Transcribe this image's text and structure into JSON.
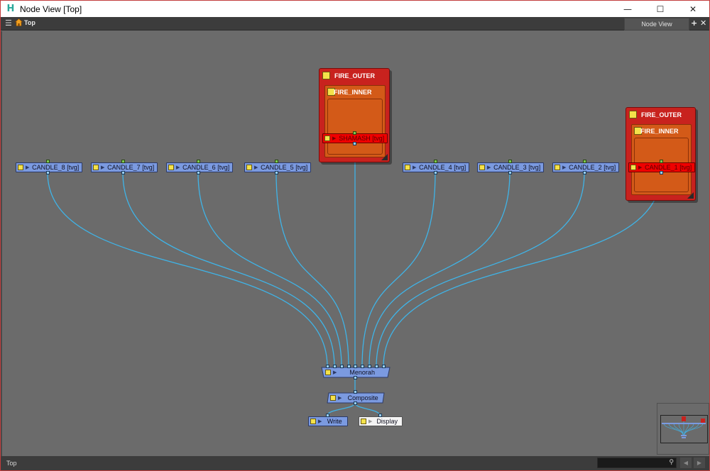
{
  "window": {
    "title": "Node View [Top]",
    "minimize_icon": "minimize-icon",
    "maximize_icon": "maximize-icon",
    "close_icon": "close-icon"
  },
  "toolbar": {
    "breadcrumb": "Top",
    "tab_label": "Node View"
  },
  "groups": {
    "shamash": {
      "outer": "FIRE_OUTER",
      "inner": "FIRE_INNER"
    },
    "candle1": {
      "outer": "FIRE_OUTER",
      "inner": "FIRE_INNER"
    }
  },
  "nodes": {
    "candle_8": "CANDLE_8  [tvg]",
    "candle_7": "CANDLE_7  [tvg]",
    "candle_6": "CANDLE_6  [tvg]",
    "candle_5": "CANDLE_5  [tvg]",
    "shamash": "SHAMASH  [tvg]",
    "candle_4": "CANDLE_4  [tvg]",
    "candle_3": "CANDLE_3  [tvg]",
    "candle_2": "CANDLE_2  [tvg]",
    "candle_1": "CANDLE_1  [tvg]",
    "menorah": "Menorah",
    "composite": "Composite",
    "write": "Write",
    "display": "Display"
  },
  "statusbar": {
    "text": "Top"
  },
  "colors": {
    "wire": "#3fb4e8",
    "node": "#7b9ae0",
    "selected_node": "#f00000",
    "group_outer": "#c8221e",
    "group_inner": "#d35a18",
    "canvas": "#6b6b6b"
  }
}
